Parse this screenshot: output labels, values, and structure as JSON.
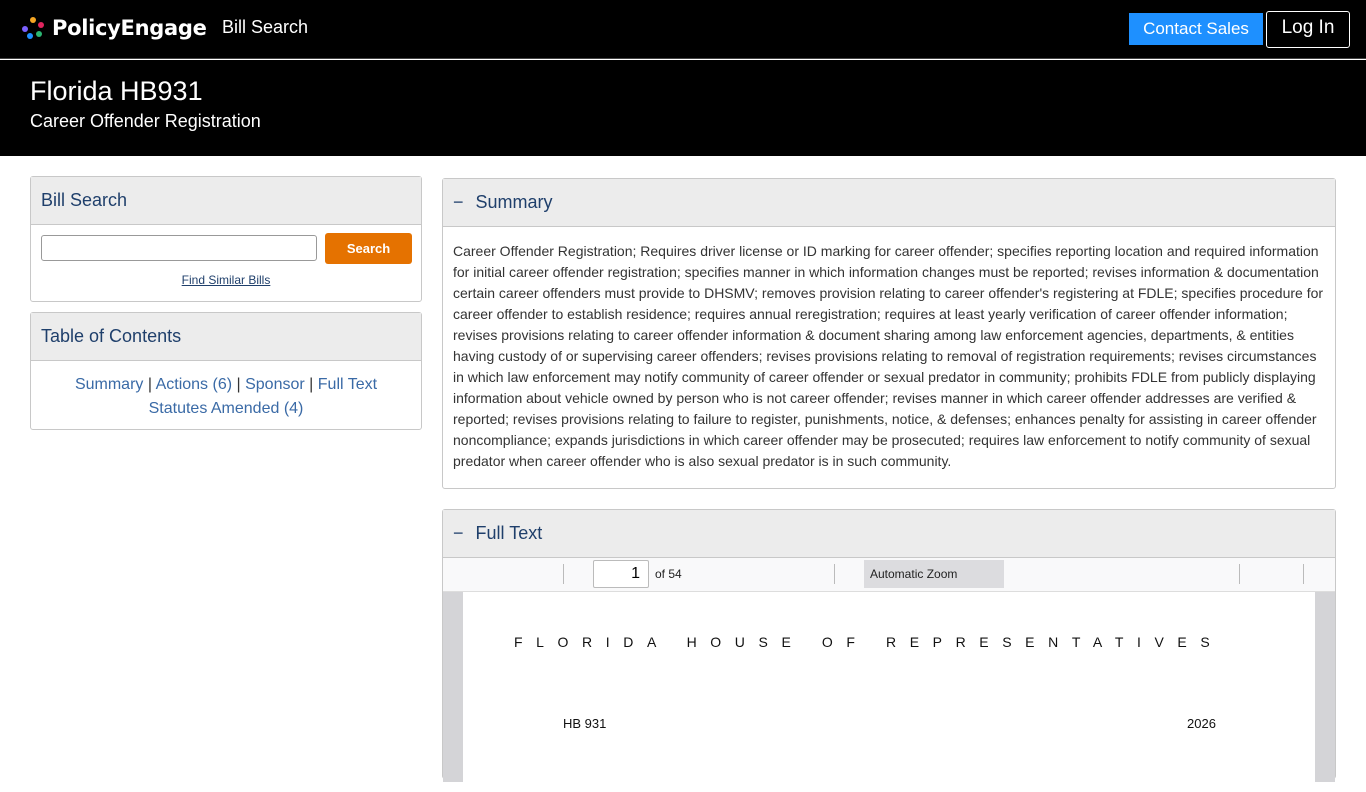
{
  "nav": {
    "brand": "PolicyEngage",
    "bill_search_link": "Bill Search",
    "contact_sales": "Contact Sales",
    "log_in": "Log In"
  },
  "header": {
    "title": "Florida HB931",
    "subtitle": "Career Offender Registration"
  },
  "sidebar": {
    "search": {
      "heading": "Bill Search",
      "input_value": "",
      "button": "Search",
      "similar_link": "Find Similar Bills"
    },
    "toc": {
      "heading": "Table of Contents",
      "links": [
        "Summary",
        "Actions (6)",
        "Sponsor",
        "Full Text",
        "Statutes Amended (4)"
      ],
      "separator": "|"
    }
  },
  "summary": {
    "toggle": "−",
    "heading": "Summary",
    "text": "Career Offender Registration; Requires driver license or ID marking for career offender; specifies reporting location and required information for initial career offender registration; specifies manner in which information changes must be reported; revises information & documentation certain career offenders must provide to DHSMV; removes provision relating to career offender's registering at FDLE; specifies procedure for career offender to establish residence; requires annual reregistration; requires at least yearly verification of career offender information; revises provisions relating to career offender information & document sharing among law enforcement agencies, departments, & entities having custody of or supervising career offenders; revises provisions relating to removal of registration requirements; revises circumstances in which law enforcement may notify community of career offender or sexual predator in community; prohibits FDLE from publicly displaying information about vehicle owned by person who is not career offender; revises manner in which career offender addresses are verified & reported; revises provisions relating to failure to register, punishments, notice, & defenses; enhances penalty for assisting in career offender noncompliance; expands jurisdictions in which career offender may be prosecuted; requires law enforcement to notify community of sexual predator when career offender who is also sexual predator is in such community."
  },
  "full_text": {
    "toggle": "−",
    "heading": "Full Text",
    "viewer": {
      "page_number": "1",
      "page_count": "of 54",
      "zoom": "Automatic Zoom",
      "doc_heading": "FLORIDA HOUSE OF REPRESENTATIVES",
      "bill_number": "HB 931",
      "year": "2026"
    }
  },
  "colors": {
    "nav_bg": "#000000",
    "contact_button": "#1e90ff",
    "search_button": "#e57200",
    "panel_heading_text": "#1f3f6b",
    "link": "#3a6aa6"
  }
}
